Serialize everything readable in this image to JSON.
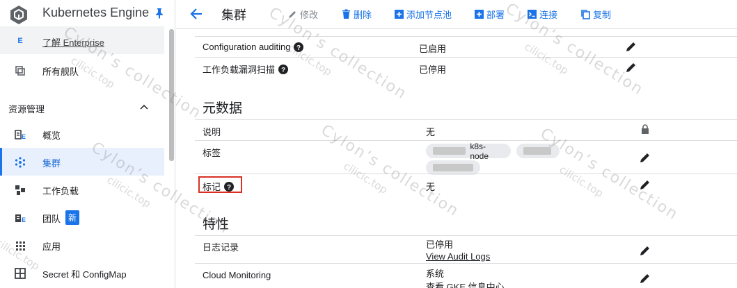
{
  "sidebar": {
    "product_title": "Kubernetes Engine",
    "items_top": [
      {
        "label": "了解 Enterprise",
        "icon": "enterprise-icon"
      },
      {
        "label": "所有舰队",
        "icon": "fleet-icon"
      }
    ],
    "section": {
      "label": "资源管理",
      "icon": "chevron-up-icon"
    },
    "items": [
      {
        "label": "概览",
        "icon": "overview-icon"
      },
      {
        "label": "集群",
        "icon": "cluster-icon",
        "active": true
      },
      {
        "label": "工作负载",
        "icon": "workloads-icon"
      },
      {
        "label": "团队",
        "icon": "teams-icon",
        "badge": "新"
      },
      {
        "label": "应用",
        "icon": "apps-icon"
      },
      {
        "label": "Secret 和 ConfigMap",
        "icon": "secret-icon"
      }
    ]
  },
  "toolbar": {
    "title": "集群",
    "edit_label": "修改",
    "delete_label": "删除",
    "add_node_pool_label": "添加节点池",
    "deploy_label": "部署",
    "connect_label": "连接",
    "duplicate_label": "复制"
  },
  "main": {
    "security_rows": [
      {
        "key": "Configuration auditing",
        "value": "已启用",
        "help": true
      },
      {
        "key": "工作负载漏洞扫描",
        "value": "已停用",
        "help": true
      }
    ],
    "metadata_title": "元数据",
    "metadata_rows": [
      {
        "key": "说明",
        "value": "无",
        "locked": true
      },
      {
        "key": "标签",
        "chips": [
          "k8s-node"
        ]
      },
      {
        "key": "标记",
        "value": "无",
        "help": true
      }
    ],
    "features_title": "特性",
    "features_rows": [
      {
        "key": "日志记录",
        "value": "已停用",
        "link": "View Audit Logs"
      },
      {
        "key": "Cloud Monitoring",
        "value": "系统",
        "link": "查看 GKE 信息中心"
      }
    ]
  },
  "watermark": {
    "line1": "Cylon’s collection",
    "line2": "cilicic.top"
  },
  "colors": {
    "accent": "#1a73e8",
    "active_bg": "#e8f0fe",
    "highlight_box": "#d93025"
  }
}
